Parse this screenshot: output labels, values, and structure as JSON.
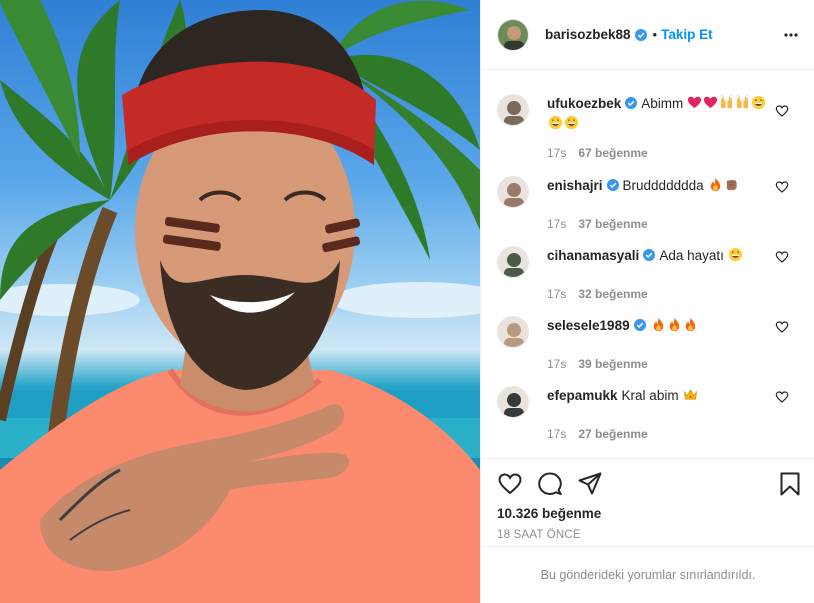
{
  "post": {
    "author": "barisozbek88",
    "follow_label": "Takip Et",
    "dot": "•",
    "photo_alt": "Man with red headband and face paint in front of palm trees and sea"
  },
  "comments": [
    {
      "user": "ufukoezbek",
      "verified": true,
      "text": "Abimm",
      "emojis": [
        "red-heart",
        "red-heart",
        "raising-hands",
        "raising-hands",
        "grin",
        "grin",
        "grin"
      ],
      "time": "17s",
      "likes": "67 beğenme",
      "avatar_color": "#7a6a5c"
    },
    {
      "user": "enishajri",
      "verified": true,
      "text": "Bruddddddda",
      "emojis": [
        "fire",
        "fist"
      ],
      "time": "17s",
      "likes": "37 beğenme",
      "avatar_color": "#9a7a6a"
    },
    {
      "user": "cihanamasyali",
      "verified": true,
      "text": "Ada hayatı",
      "emojis": [
        "grin"
      ],
      "time": "17s",
      "likes": "32 beğenme",
      "avatar_color": "#4c5a4a"
    },
    {
      "user": "selesele1989",
      "verified": true,
      "text": "",
      "emojis": [
        "fire",
        "fire",
        "fire"
      ],
      "time": "17s",
      "likes": "39 beğenme",
      "avatar_color": "#b89a80"
    },
    {
      "user": "efepamukk",
      "verified": false,
      "text": "Kral abim",
      "emojis": [
        "crown"
      ],
      "time": "17s",
      "likes": "27 beğenme",
      "avatar_color": "#3a3a3a"
    }
  ],
  "stats": {
    "likes": "10.326 beğenme",
    "time": "18 SAAT ÖNCE"
  },
  "restricted_text": "Bu gönderideki yorumlar sınırlandırıldı.",
  "colors": {
    "accent": "#0095f6",
    "verified": "#3897f0",
    "secondary_text": "#8e8e8e",
    "divider": "#efefef"
  },
  "icons": [
    "more-icon",
    "heart-icon",
    "comment-icon",
    "share-icon",
    "bookmark-icon",
    "verified-icon"
  ]
}
